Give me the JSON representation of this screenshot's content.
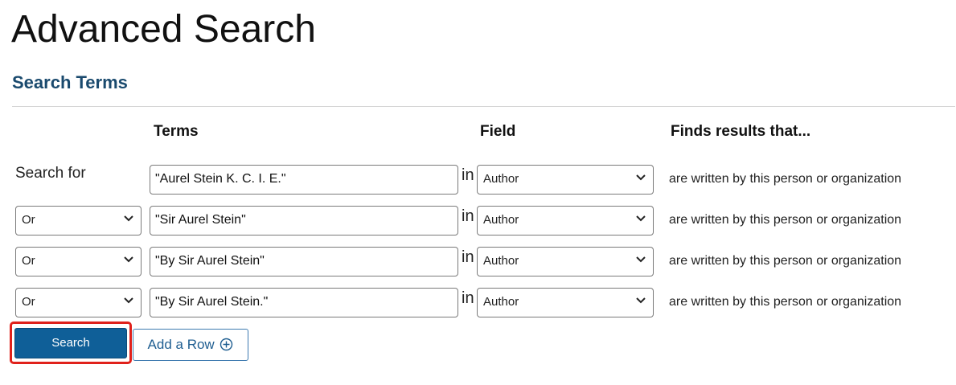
{
  "page": {
    "title": "Advanced Search"
  },
  "section": {
    "title": "Search Terms"
  },
  "columns": {
    "terms": "Terms",
    "field": "Field",
    "finds": "Finds results that..."
  },
  "first_row_label": "Search for",
  "rows": [
    {
      "operator": null,
      "term": "\"Aurel Stein K. C. I. E.\"",
      "in_label": "in",
      "field": "Author",
      "description": "are written by this person or organization"
    },
    {
      "operator": "Or",
      "term": "\"Sir Aurel Stein\"",
      "in_label": "in",
      "field": "Author",
      "description": "are written by this person or organization"
    },
    {
      "operator": "Or",
      "term": "\"By Sir Aurel Stein\"",
      "in_label": "in",
      "field": "Author",
      "description": "are written by this person or organization"
    },
    {
      "operator": "Or",
      "term": "\"By Sir Aurel Stein.\"",
      "in_label": "in",
      "field": "Author",
      "description": "are written by this person or organization"
    }
  ],
  "buttons": {
    "search": "Search",
    "add_row": "Add a Row"
  },
  "colors": {
    "accent": "#0f5f98",
    "heading": "#1a4a6e",
    "highlight": "#e0211b"
  },
  "icons": {
    "select_chevron": "chevron-down-icon",
    "add_row": "plus-circle-icon"
  }
}
